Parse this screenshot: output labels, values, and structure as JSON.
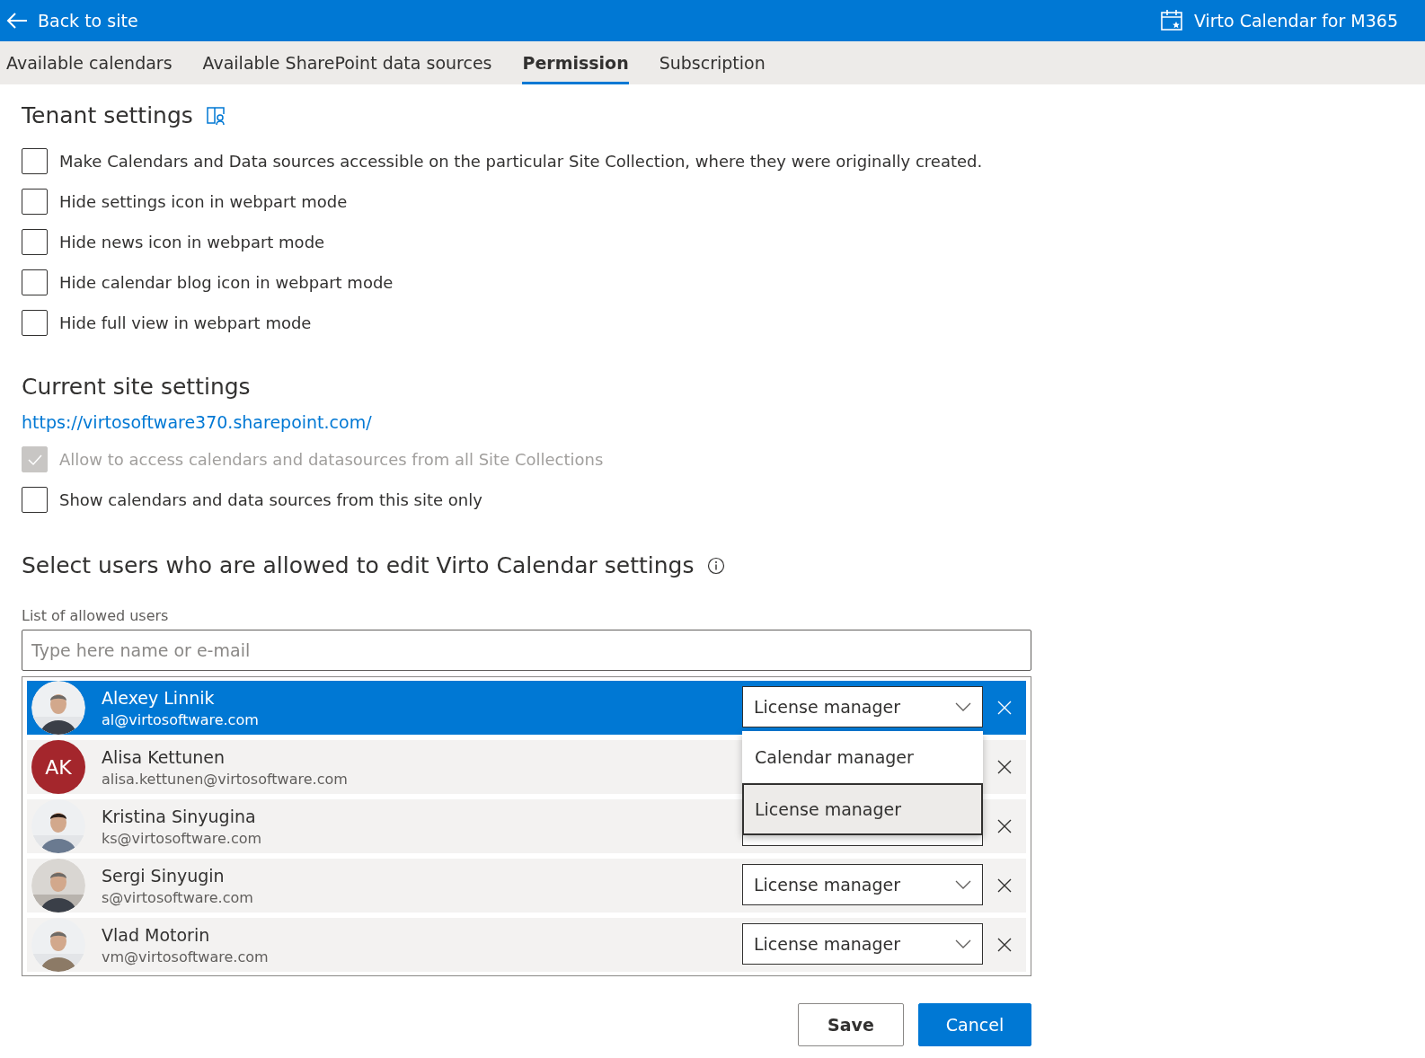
{
  "header": {
    "back": "Back to site",
    "app_title": "Virto Calendar for M365"
  },
  "tabs": [
    {
      "label": "Available calendars",
      "selected": false
    },
    {
      "label": "Available SharePoint data sources",
      "selected": false
    },
    {
      "label": "Permission",
      "selected": true
    },
    {
      "label": "Subscription",
      "selected": false
    }
  ],
  "tenant": {
    "title": "Tenant settings",
    "options": [
      {
        "label": "Make Calendars and Data sources accessible on the particular Site Collection, where they were originally created.",
        "checked": false,
        "disabled": false
      },
      {
        "label": "Hide settings icon in webpart mode",
        "checked": false,
        "disabled": false
      },
      {
        "label": "Hide news icon in webpart mode",
        "checked": false,
        "disabled": false
      },
      {
        "label": "Hide calendar blog icon in webpart mode",
        "checked": false,
        "disabled": false
      },
      {
        "label": "Hide full view in webpart mode",
        "checked": false,
        "disabled": false
      }
    ]
  },
  "site": {
    "title": "Current site settings",
    "url": "https://virtosoftware370.sharepoint.com/",
    "options": [
      {
        "label": "Allow to access calendars and datasources from all Site Collections",
        "checked": true,
        "disabled": true
      },
      {
        "label": "Show calendars and data sources from this site only",
        "checked": false,
        "disabled": false
      }
    ]
  },
  "users": {
    "title": "Select users who are allowed to edit Virto Calendar settings",
    "list_label": "List of allowed users",
    "placeholder": "Type here name or e-mail",
    "items": [
      {
        "name": "Alexey Linnik",
        "email": "al@virtosoftware.com",
        "selected": true,
        "role": "License manager"
      },
      {
        "name": "Alisa Kettunen",
        "email": "alisa.kettunen@virtosoftware.com",
        "selected": false,
        "avatar": {
          "kind": "initials",
          "initials": "AK",
          "color": "#a4262c"
        }
      },
      {
        "name": "Kristina Sinyugina",
        "email": "ks@virtosoftware.com",
        "selected": false,
        "dropdown_partly_hidden": true
      },
      {
        "name": "Sergi Sinyugin",
        "email": "s@virtosoftware.com",
        "selected": false,
        "role": "License manager"
      },
      {
        "name": "Vlad Motorin",
        "email": "vm@virtosoftware.com",
        "selected": false,
        "role": "License manager"
      }
    ],
    "menu": [
      {
        "label": "Calendar manager",
        "selected": false
      },
      {
        "label": "License manager",
        "selected": true
      }
    ]
  },
  "buttons": [
    {
      "label": "Save",
      "kind": "secondary"
    },
    {
      "label": "Cancel",
      "kind": "primary"
    }
  ]
}
